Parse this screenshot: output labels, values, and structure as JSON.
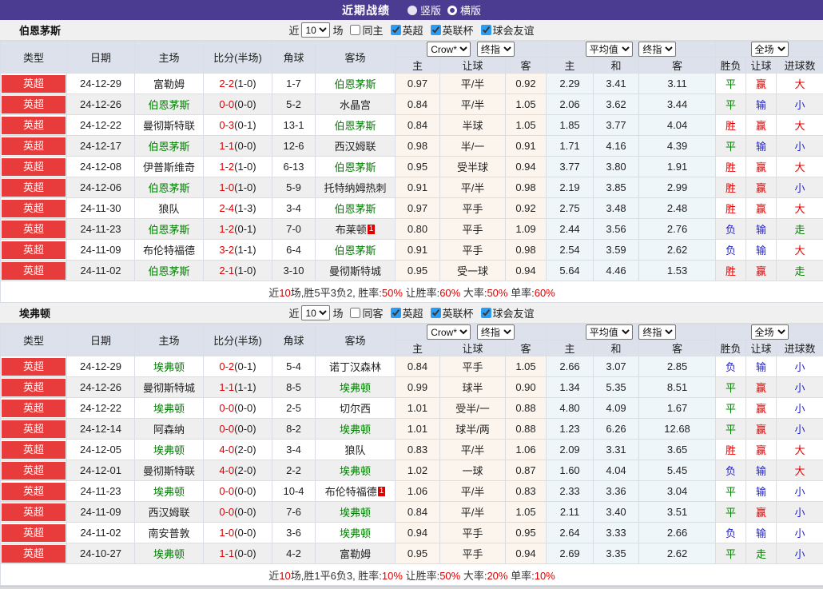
{
  "title_bar": {
    "title": "近期战绩",
    "vertical": "竖版",
    "horizontal": "横版"
  },
  "filter_labels": {
    "near": "近",
    "count": "10",
    "games": "场",
    "leagues": [
      "英超",
      "英联杯",
      "球会友谊"
    ]
  },
  "dropdowns": {
    "company": "Crow*",
    "final": "终指",
    "average": "平均值",
    "final2": "终指",
    "scope": "全场"
  },
  "columns": {
    "type": "类型",
    "date": "日期",
    "home": "主场",
    "score": "比分(半场)",
    "corner": "角球",
    "away": "客场",
    "odds_home": "主",
    "handicap": "让球",
    "odds_away": "客",
    "avg_home": "主",
    "avg_draw": "和",
    "avg_away": "客",
    "result": "胜负",
    "handicap_result": "让球",
    "goals": "进球数"
  },
  "colors": {
    "accent_purple": "#4b3c92",
    "league_red": "#e83c3c",
    "win_red": "#e00000",
    "draw_green": "#008000",
    "lose_blue": "#2323cc",
    "avg_bg": "#eef6fa",
    "odds_bg": "#fbf5ee"
  },
  "sections": [
    {
      "team": "伯恩茅斯",
      "filter_same": "同主",
      "rows": [
        {
          "league": "英超",
          "date": "24-12-29",
          "home": "富勒姆",
          "home_c": "black",
          "score": "2-2",
          "half": "(1-0)",
          "corner": "1-7",
          "away": "伯恩茅斯",
          "away_c": "green",
          "oh": "0.97",
          "hcap": "平/半",
          "oa": "0.92",
          "ah": "2.29",
          "ad": "3.41",
          "aa": "3.11",
          "res": "平",
          "res_c": "green",
          "hres": "赢",
          "hres_c": "red",
          "goal": "大",
          "goal_c": "red"
        },
        {
          "league": "英超",
          "date": "24-12-26",
          "home": "伯恩茅斯",
          "home_c": "green",
          "score": "0-0",
          "half": "(0-0)",
          "corner": "5-2",
          "away": "水晶宫",
          "away_c": "black",
          "oh": "0.84",
          "hcap": "平/半",
          "oa": "1.05",
          "ah": "2.06",
          "ad": "3.62",
          "aa": "3.44",
          "res": "平",
          "res_c": "green",
          "hres": "输",
          "hres_c": "blue",
          "goal": "小",
          "goal_c": "blue"
        },
        {
          "league": "英超",
          "date": "24-12-22",
          "home": "曼彻斯特联",
          "home_c": "black",
          "score": "0-3",
          "half": "(0-1)",
          "corner": "13-1",
          "away": "伯恩茅斯",
          "away_c": "green",
          "oh": "0.84",
          "hcap": "半球",
          "oa": "1.05",
          "ah": "1.85",
          "ad": "3.77",
          "aa": "4.04",
          "res": "胜",
          "res_c": "red",
          "hres": "赢",
          "hres_c": "red",
          "goal": "大",
          "goal_c": "red"
        },
        {
          "league": "英超",
          "date": "24-12-17",
          "home": "伯恩茅斯",
          "home_c": "green",
          "score": "1-1",
          "half": "(0-0)",
          "corner": "12-6",
          "away": "西汉姆联",
          "away_c": "black",
          "oh": "0.98",
          "hcap": "半/一",
          "oa": "0.91",
          "ah": "1.71",
          "ad": "4.16",
          "aa": "4.39",
          "res": "平",
          "res_c": "green",
          "hres": "输",
          "hres_c": "blue",
          "goal": "小",
          "goal_c": "blue"
        },
        {
          "league": "英超",
          "date": "24-12-08",
          "home": "伊普斯维奇",
          "home_c": "black",
          "score": "1-2",
          "half": "(1-0)",
          "corner": "6-13",
          "away": "伯恩茅斯",
          "away_c": "green",
          "oh": "0.95",
          "hcap": "受半球",
          "oa": "0.94",
          "ah": "3.77",
          "ad": "3.80",
          "aa": "1.91",
          "res": "胜",
          "res_c": "red",
          "hres": "赢",
          "hres_c": "red",
          "goal": "大",
          "goal_c": "red"
        },
        {
          "league": "英超",
          "date": "24-12-06",
          "home": "伯恩茅斯",
          "home_c": "green",
          "score": "1-0",
          "half": "(1-0)",
          "corner": "5-9",
          "away": "托特纳姆热刺",
          "away_c": "black",
          "oh": "0.91",
          "hcap": "平/半",
          "oa": "0.98",
          "ah": "2.19",
          "ad": "3.85",
          "aa": "2.99",
          "res": "胜",
          "res_c": "red",
          "hres": "赢",
          "hres_c": "red",
          "goal": "小",
          "goal_c": "blue"
        },
        {
          "league": "英超",
          "date": "24-11-30",
          "home": "狼队",
          "home_c": "black",
          "score": "2-4",
          "half": "(1-3)",
          "corner": "3-4",
          "away": "伯恩茅斯",
          "away_c": "green",
          "oh": "0.97",
          "hcap": "平手",
          "oa": "0.92",
          "ah": "2.75",
          "ad": "3.48",
          "aa": "2.48",
          "res": "胜",
          "res_c": "red",
          "hres": "赢",
          "hres_c": "red",
          "goal": "大",
          "goal_c": "red"
        },
        {
          "league": "英超",
          "date": "24-11-23",
          "home": "伯恩茅斯",
          "home_c": "green",
          "score": "1-2",
          "half": "(0-1)",
          "corner": "7-0",
          "away": "布莱顿",
          "away_c": "black",
          "away_badge": "1",
          "oh": "0.80",
          "hcap": "平手",
          "oa": "1.09",
          "ah": "2.44",
          "ad": "3.56",
          "aa": "2.76",
          "res": "负",
          "res_c": "blue",
          "hres": "输",
          "hres_c": "blue",
          "goal": "走",
          "goal_c": "green"
        },
        {
          "league": "英超",
          "date": "24-11-09",
          "home": "布伦特福德",
          "home_c": "black",
          "score": "3-2",
          "half": "(1-1)",
          "corner": "6-4",
          "away": "伯恩茅斯",
          "away_c": "green",
          "oh": "0.91",
          "hcap": "平手",
          "oa": "0.98",
          "ah": "2.54",
          "ad": "3.59",
          "aa": "2.62",
          "res": "负",
          "res_c": "blue",
          "hres": "输",
          "hres_c": "blue",
          "goal": "大",
          "goal_c": "red"
        },
        {
          "league": "英超",
          "date": "24-11-02",
          "home": "伯恩茅斯",
          "home_c": "green",
          "score": "2-1",
          "half": "(1-0)",
          "corner": "3-10",
          "away": "曼彻斯特城",
          "away_c": "black",
          "oh": "0.95",
          "hcap": "受一球",
          "oa": "0.94",
          "ah": "5.64",
          "ad": "4.46",
          "aa": "1.53",
          "res": "胜",
          "res_c": "red",
          "hres": "赢",
          "hres_c": "red",
          "goal": "走",
          "goal_c": "green"
        }
      ],
      "summary": [
        {
          "t": "近",
          "c": "dark"
        },
        {
          "t": "10",
          "c": "red"
        },
        {
          "t": "场,胜5平3负2, 胜率:",
          "c": "dark"
        },
        {
          "t": "50%",
          "c": "red"
        },
        {
          "t": " 让胜率:",
          "c": "dark"
        },
        {
          "t": "60%",
          "c": "red"
        },
        {
          "t": " 大率:",
          "c": "dark"
        },
        {
          "t": "50%",
          "c": "red"
        },
        {
          "t": " 单率:",
          "c": "dark"
        },
        {
          "t": "60%",
          "c": "red"
        }
      ]
    },
    {
      "team": "埃弗顿",
      "filter_same": "同客",
      "rows": [
        {
          "league": "英超",
          "date": "24-12-29",
          "home": "埃弗顿",
          "home_c": "green",
          "score": "0-2",
          "half": "(0-1)",
          "corner": "5-4",
          "away": "诺丁汉森林",
          "away_c": "black",
          "oh": "0.84",
          "hcap": "平手",
          "oa": "1.05",
          "ah": "2.66",
          "ad": "3.07",
          "aa": "2.85",
          "res": "负",
          "res_c": "blue",
          "hres": "输",
          "hres_c": "blue",
          "goal": "小",
          "goal_c": "blue"
        },
        {
          "league": "英超",
          "date": "24-12-26",
          "home": "曼彻斯特城",
          "home_c": "black",
          "score": "1-1",
          "half": "(1-1)",
          "corner": "8-5",
          "away": "埃弗顿",
          "away_c": "green",
          "oh": "0.99",
          "hcap": "球半",
          "oa": "0.90",
          "ah": "1.34",
          "ad": "5.35",
          "aa": "8.51",
          "res": "平",
          "res_c": "green",
          "hres": "赢",
          "hres_c": "red",
          "goal": "小",
          "goal_c": "blue"
        },
        {
          "league": "英超",
          "date": "24-12-22",
          "home": "埃弗顿",
          "home_c": "green",
          "score": "0-0",
          "half": "(0-0)",
          "corner": "2-5",
          "away": "切尔西",
          "away_c": "black",
          "oh": "1.01",
          "hcap": "受半/一",
          "oa": "0.88",
          "ah": "4.80",
          "ad": "4.09",
          "aa": "1.67",
          "res": "平",
          "res_c": "green",
          "hres": "赢",
          "hres_c": "red",
          "goal": "小",
          "goal_c": "blue"
        },
        {
          "league": "英超",
          "date": "24-12-14",
          "home": "阿森纳",
          "home_c": "black",
          "score": "0-0",
          "half": "(0-0)",
          "corner": "8-2",
          "away": "埃弗顿",
          "away_c": "green",
          "oh": "1.01",
          "hcap": "球半/两",
          "oa": "0.88",
          "ah": "1.23",
          "ad": "6.26",
          "aa": "12.68",
          "res": "平",
          "res_c": "green",
          "hres": "赢",
          "hres_c": "red",
          "goal": "小",
          "goal_c": "blue"
        },
        {
          "league": "英超",
          "date": "24-12-05",
          "home": "埃弗顿",
          "home_c": "green",
          "score": "4-0",
          "half": "(2-0)",
          "corner": "3-4",
          "away": "狼队",
          "away_c": "black",
          "oh": "0.83",
          "hcap": "平/半",
          "oa": "1.06",
          "ah": "2.09",
          "ad": "3.31",
          "aa": "3.65",
          "res": "胜",
          "res_c": "red",
          "hres": "赢",
          "hres_c": "red",
          "goal": "大",
          "goal_c": "red"
        },
        {
          "league": "英超",
          "date": "24-12-01",
          "home": "曼彻斯特联",
          "home_c": "black",
          "score": "4-0",
          "half": "(2-0)",
          "corner": "2-2",
          "away": "埃弗顿",
          "away_c": "green",
          "oh": "1.02",
          "hcap": "一球",
          "oa": "0.87",
          "ah": "1.60",
          "ad": "4.04",
          "aa": "5.45",
          "res": "负",
          "res_c": "blue",
          "hres": "输",
          "hres_c": "blue",
          "goal": "大",
          "goal_c": "red"
        },
        {
          "league": "英超",
          "date": "24-11-23",
          "home": "埃弗顿",
          "home_c": "green",
          "score": "0-0",
          "half": "(0-0)",
          "corner": "10-4",
          "away": "布伦特福德",
          "away_c": "black",
          "away_badge": "1",
          "oh": "1.06",
          "hcap": "平/半",
          "oa": "0.83",
          "ah": "2.33",
          "ad": "3.36",
          "aa": "3.04",
          "res": "平",
          "res_c": "green",
          "hres": "输",
          "hres_c": "blue",
          "goal": "小",
          "goal_c": "blue"
        },
        {
          "league": "英超",
          "date": "24-11-09",
          "home": "西汉姆联",
          "home_c": "black",
          "score": "0-0",
          "half": "(0-0)",
          "corner": "7-6",
          "away": "埃弗顿",
          "away_c": "green",
          "oh": "0.84",
          "hcap": "平/半",
          "oa": "1.05",
          "ah": "2.11",
          "ad": "3.40",
          "aa": "3.51",
          "res": "平",
          "res_c": "green",
          "hres": "赢",
          "hres_c": "red",
          "goal": "小",
          "goal_c": "blue"
        },
        {
          "league": "英超",
          "date": "24-11-02",
          "home": "南安普敦",
          "home_c": "black",
          "score": "1-0",
          "half": "(0-0)",
          "corner": "3-6",
          "away": "埃弗顿",
          "away_c": "green",
          "oh": "0.94",
          "hcap": "平手",
          "oa": "0.95",
          "ah": "2.64",
          "ad": "3.33",
          "aa": "2.66",
          "res": "负",
          "res_c": "blue",
          "hres": "输",
          "hres_c": "blue",
          "goal": "小",
          "goal_c": "blue"
        },
        {
          "league": "英超",
          "date": "24-10-27",
          "home": "埃弗顿",
          "home_c": "green",
          "score": "1-1",
          "half": "(0-0)",
          "corner": "4-2",
          "away": "富勒姆",
          "away_c": "black",
          "oh": "0.95",
          "hcap": "平手",
          "oa": "0.94",
          "ah": "2.69",
          "ad": "3.35",
          "aa": "2.62",
          "res": "平",
          "res_c": "green",
          "hres": "走",
          "hres_c": "green",
          "goal": "小",
          "goal_c": "blue"
        }
      ],
      "summary": [
        {
          "t": "近",
          "c": "dark"
        },
        {
          "t": "10",
          "c": "red"
        },
        {
          "t": "场,胜1平6负3, 胜率:",
          "c": "dark"
        },
        {
          "t": "10%",
          "c": "red"
        },
        {
          "t": " 让胜率:",
          "c": "dark"
        },
        {
          "t": "50%",
          "c": "red"
        },
        {
          "t": " 大率:",
          "c": "dark"
        },
        {
          "t": "20%",
          "c": "red"
        },
        {
          "t": " 单率:",
          "c": "dark"
        },
        {
          "t": "10%",
          "c": "red"
        }
      ]
    }
  ]
}
